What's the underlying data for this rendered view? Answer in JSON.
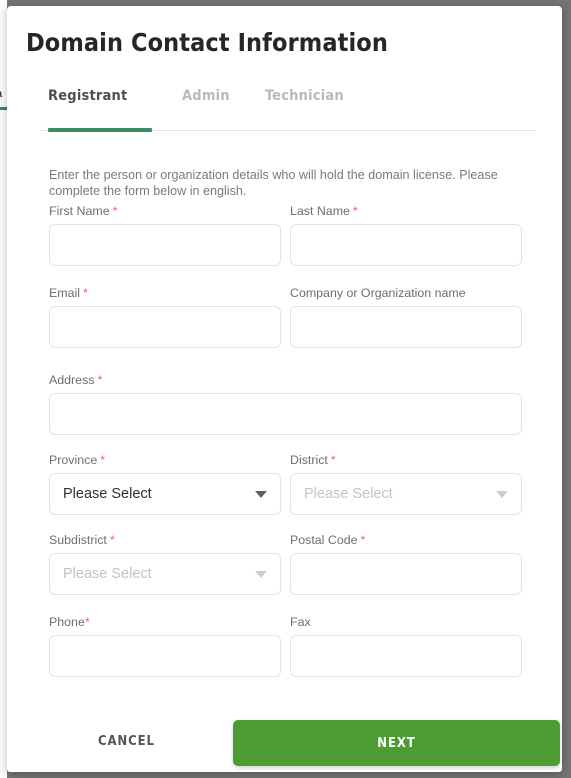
{
  "modal": {
    "title": "Domain Contact Information",
    "tabs": [
      {
        "label": "Registrant",
        "active": true
      },
      {
        "label": "Admin",
        "active": false
      },
      {
        "label": "Technician",
        "active": false
      }
    ],
    "intro": "Enter the person or organization details who will hold the domain license. Please complete the form below in english.",
    "fields": {
      "first_name": {
        "label": "First Name",
        "required_mark": "*",
        "value": "",
        "placeholder": ""
      },
      "last_name": {
        "label": "Last Name",
        "required_mark": "*",
        "value": "",
        "placeholder": ""
      },
      "email": {
        "label": "Email",
        "required_mark": "*",
        "value": "",
        "placeholder": ""
      },
      "company": {
        "label": "Company or Organization name",
        "required_mark": "",
        "value": "",
        "placeholder": ""
      },
      "address": {
        "label": "Address",
        "required_mark": "*",
        "value": "",
        "placeholder": ""
      },
      "province": {
        "label": "Province",
        "required_mark": "*",
        "selected": "Please Select",
        "enabled": true
      },
      "district": {
        "label": "District",
        "required_mark": "*",
        "selected": "Please Select",
        "enabled": false
      },
      "subdistrict": {
        "label": "Subdistrict",
        "required_mark": "*",
        "selected": "Please Select",
        "enabled": false
      },
      "postal_code": {
        "label": "Postal Code",
        "required_mark": "*",
        "value": "",
        "placeholder": ""
      },
      "phone": {
        "label": "Phone",
        "required_mark": "*",
        "value": "",
        "placeholder": ""
      },
      "fax": {
        "label": "Fax",
        "required_mark": "",
        "value": "",
        "placeholder": ""
      }
    },
    "footer": {
      "cancel_label": "CANCEL",
      "next_label": "NEXT"
    }
  },
  "background": {
    "sliver_text": "a"
  },
  "colors": {
    "accent_green": "#3a8c63",
    "button_green": "#4d9b33",
    "required_red": "#f4606c",
    "overlay_gray": "#757575",
    "title_text": "#262626",
    "muted_text": "#7a7a7a"
  }
}
